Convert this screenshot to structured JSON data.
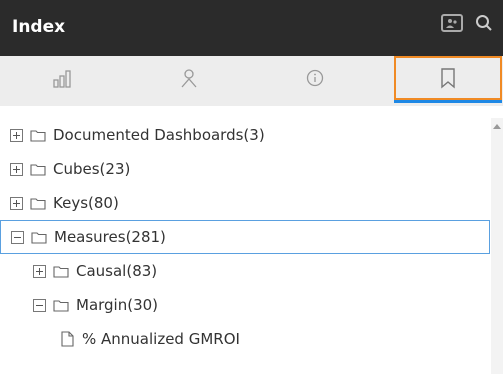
{
  "header": {
    "title": "Index",
    "icons": [
      "presentation-icon",
      "search-icon"
    ],
    "background": "#2b2b2b"
  },
  "tabs": [
    {
      "name": "metrics",
      "icon": "bar-chart-icon"
    },
    {
      "name": "user",
      "icon": "user-icon"
    },
    {
      "name": "info",
      "icon": "info-icon"
    },
    {
      "name": "bookmarks",
      "icon": "bookmark-icon",
      "active": true
    }
  ],
  "colors": {
    "accent": "#1e88e5",
    "active_outline": "#f08a24",
    "selection": "#5aa0e0"
  },
  "tree": [
    {
      "label": "Documented Dashboards(3)",
      "toggle": "plus",
      "type": "folder",
      "level": 0
    },
    {
      "label": "Cubes(23)",
      "toggle": "plus",
      "type": "folder",
      "level": 0
    },
    {
      "label": "Keys(80)",
      "toggle": "plus",
      "type": "folder",
      "level": 0
    },
    {
      "label": "Measures(281)",
      "toggle": "minus",
      "type": "folder",
      "level": 0,
      "selected": true
    },
    {
      "label": "Causal(83)",
      "toggle": "plus",
      "type": "folder",
      "level": 1
    },
    {
      "label": "Margin(30)",
      "toggle": "minus",
      "type": "folder",
      "level": 1
    },
    {
      "label": "% Annualized GMROI",
      "type": "file",
      "level": 2
    }
  ]
}
